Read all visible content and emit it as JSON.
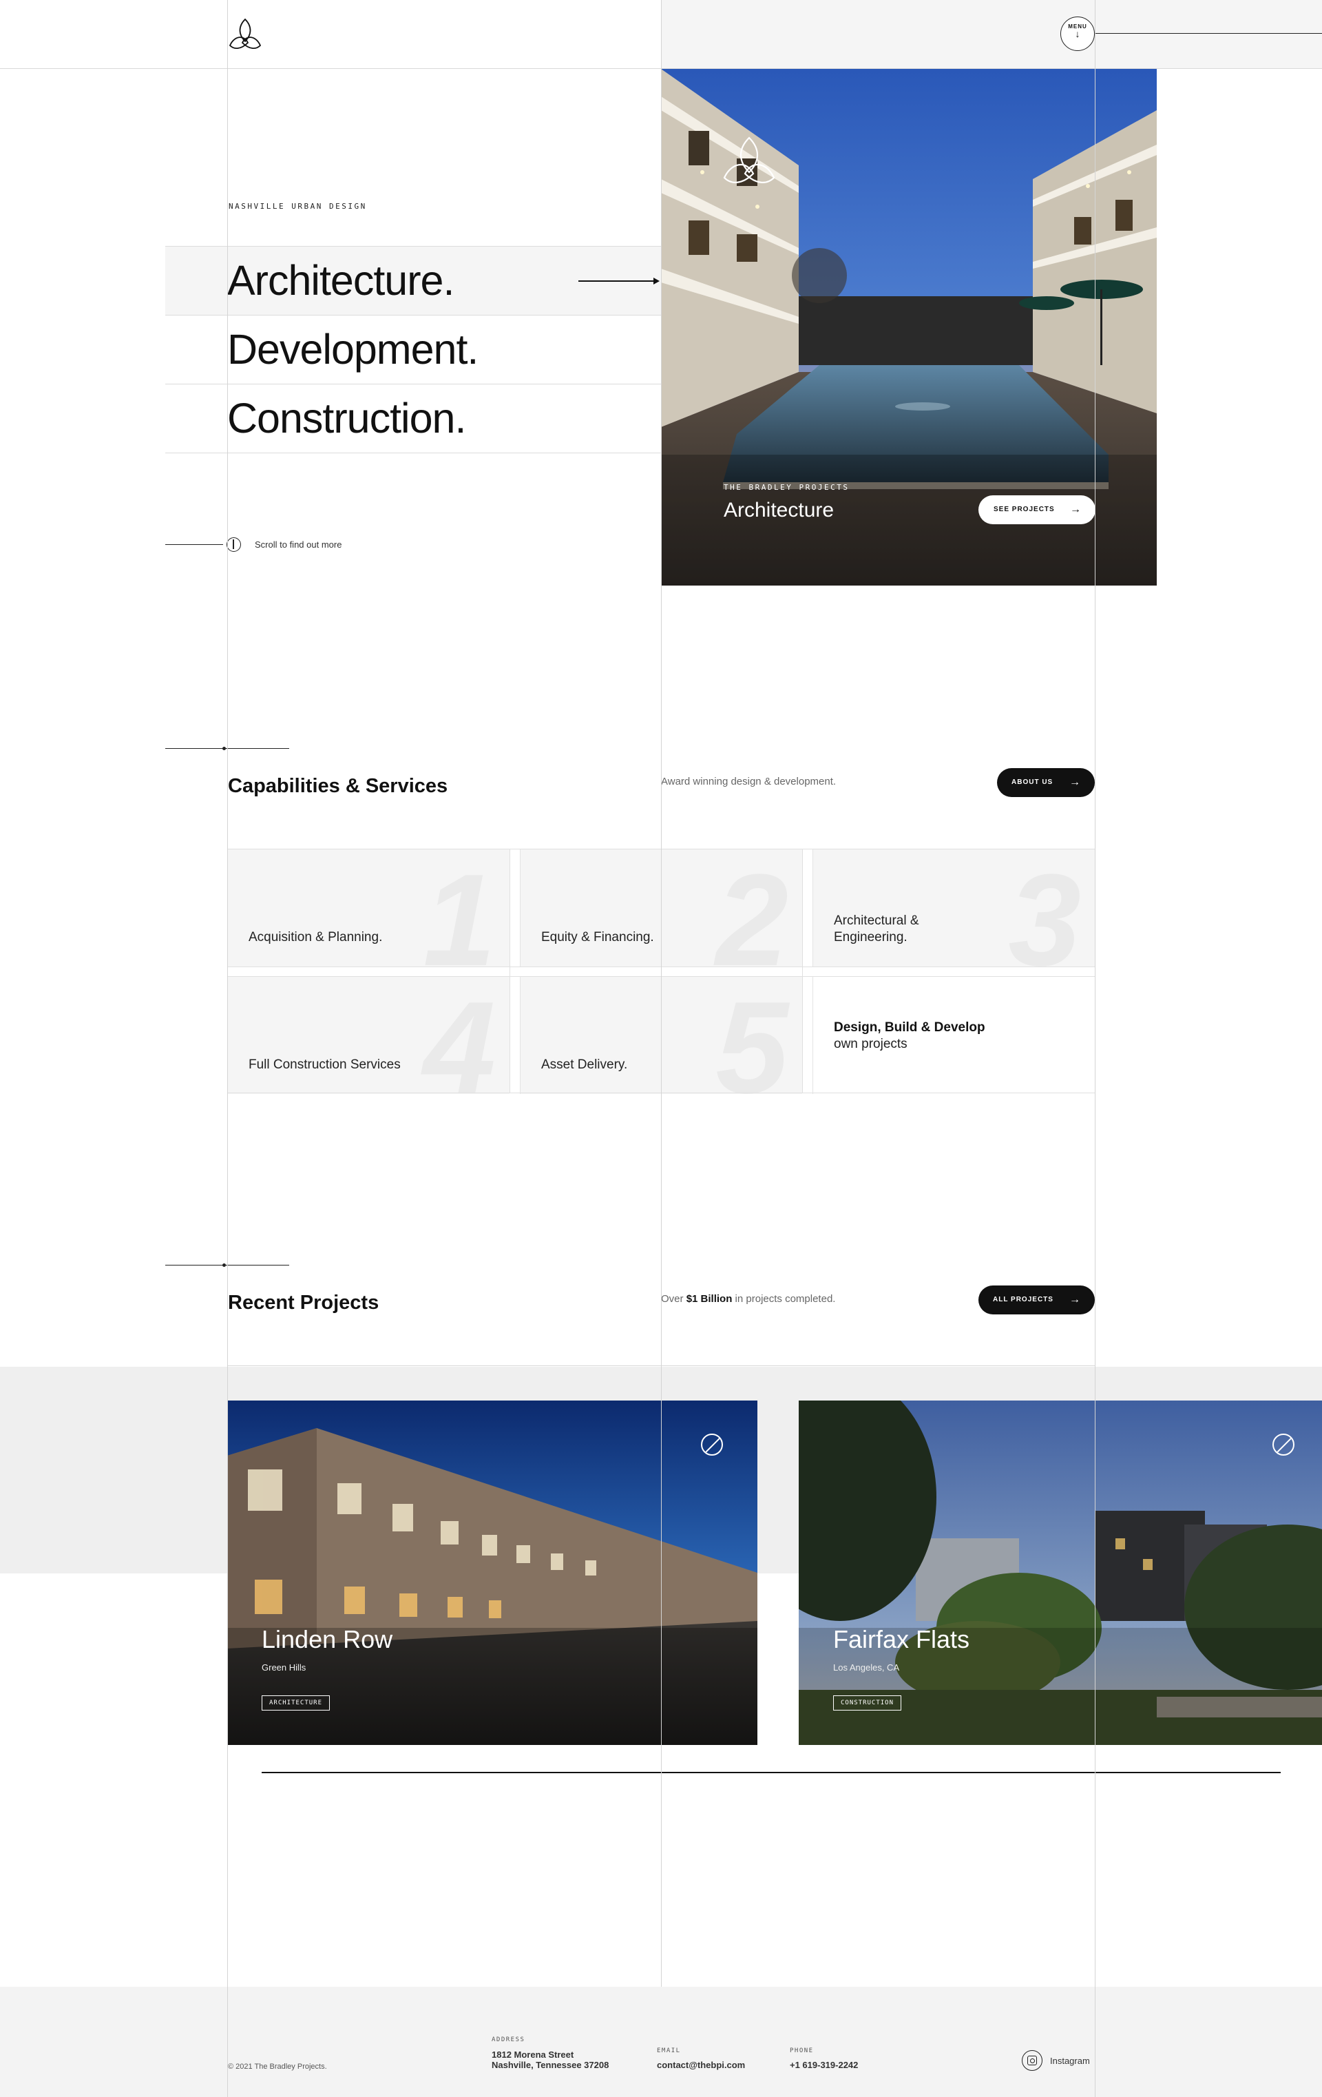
{
  "brand": {
    "logo_icon": "trefoil-leaf-logo-icon"
  },
  "header": {
    "menu_label": "MENU",
    "menu_icon": "arrow-down-icon"
  },
  "hero": {
    "eyebrow": "NASHVILLE URBAN DESIGN",
    "words": [
      "Architecture.",
      "Development.",
      "Construction."
    ],
    "active_index": 0,
    "scroll_text": "Scroll to find out more",
    "image": {
      "eyebrow": "THE BRADLEY PROJECTS",
      "title": "Architecture",
      "button_label": "SEE PROJECTS"
    }
  },
  "capabilities": {
    "title": "Capabilities & Services",
    "subtitle": "Award winning design & development.",
    "button_label": "ABOUT US",
    "items": [
      {
        "number": "1",
        "label": "Acquisition & Planning."
      },
      {
        "number": "2",
        "label": "Equity & Financing."
      },
      {
        "number": "3",
        "label": "Architectural & Engineering."
      },
      {
        "number": "4",
        "label": "Full Construction Services"
      },
      {
        "number": "5",
        "label": "Asset Delivery."
      }
    ],
    "highlight": {
      "bold": "Design, Build & Develop",
      "text": "own projects"
    }
  },
  "projects": {
    "title": "Recent Projects",
    "subtitle_prefix": "Over",
    "subtitle_bold": "$1 Billion",
    "subtitle_suffix": "in projects completed.",
    "button_label": "ALL PROJECTS",
    "items": [
      {
        "title": "Linden Row",
        "location": "Green Hills",
        "tag": "ARCHITECTURE"
      },
      {
        "title": "Fairfax Flats",
        "location": "Los Angeles, CA",
        "tag": "CONSTRUCTION"
      }
    ]
  },
  "footer": {
    "copyright": "© 2021 The Bradley Projects.",
    "address_label": "ADDRESS",
    "address_line1": "1812 Morena Street",
    "address_line2": "Nashville, Tennessee 37208",
    "email_label": "EMAIL",
    "email": "contact@thebpi.com",
    "phone_label": "PHONE",
    "phone": "+1 619-319-2242",
    "social_label": "Instagram"
  },
  "colors": {
    "accent": "#111111",
    "panel": "#f5f5f5",
    "grid_line": "#d4d4d4"
  }
}
